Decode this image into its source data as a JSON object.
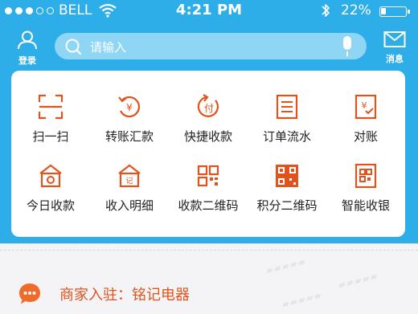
{
  "status_bar": {
    "carrier": "BELL",
    "time": "4:21 PM",
    "battery": "22%",
    "battery_level": 0.22,
    "signal_bars_filled": 3,
    "signal_bars_total": 5
  },
  "header": {
    "login_label": "登录",
    "messages_label": "消息",
    "search_placeholder": "请输入"
  },
  "grid": [
    {
      "label": "扫一扫",
      "icon": "scan-icon"
    },
    {
      "label": "转账汇款",
      "icon": "transfer-icon"
    },
    {
      "label": "快捷收款",
      "icon": "quick-pay-icon"
    },
    {
      "label": "订单流水",
      "icon": "order-list-icon"
    },
    {
      "label": "对账",
      "icon": "reconcile-icon"
    },
    {
      "label": "今日收款",
      "icon": "today-income-icon"
    },
    {
      "label": "收入明细",
      "icon": "income-detail-icon"
    },
    {
      "label": "收款二维码",
      "icon": "qr-code-icon"
    },
    {
      "label": "积分二维码",
      "icon": "points-qr-icon"
    },
    {
      "label": "智能收银",
      "icon": "smart-cashier-icon"
    }
  ],
  "notice": {
    "text": "商家入驻：铭记电器"
  },
  "colors": {
    "header_blue": "#2eaee9",
    "accent_orange": "#e0531c",
    "card_bg": "#ffffff"
  }
}
